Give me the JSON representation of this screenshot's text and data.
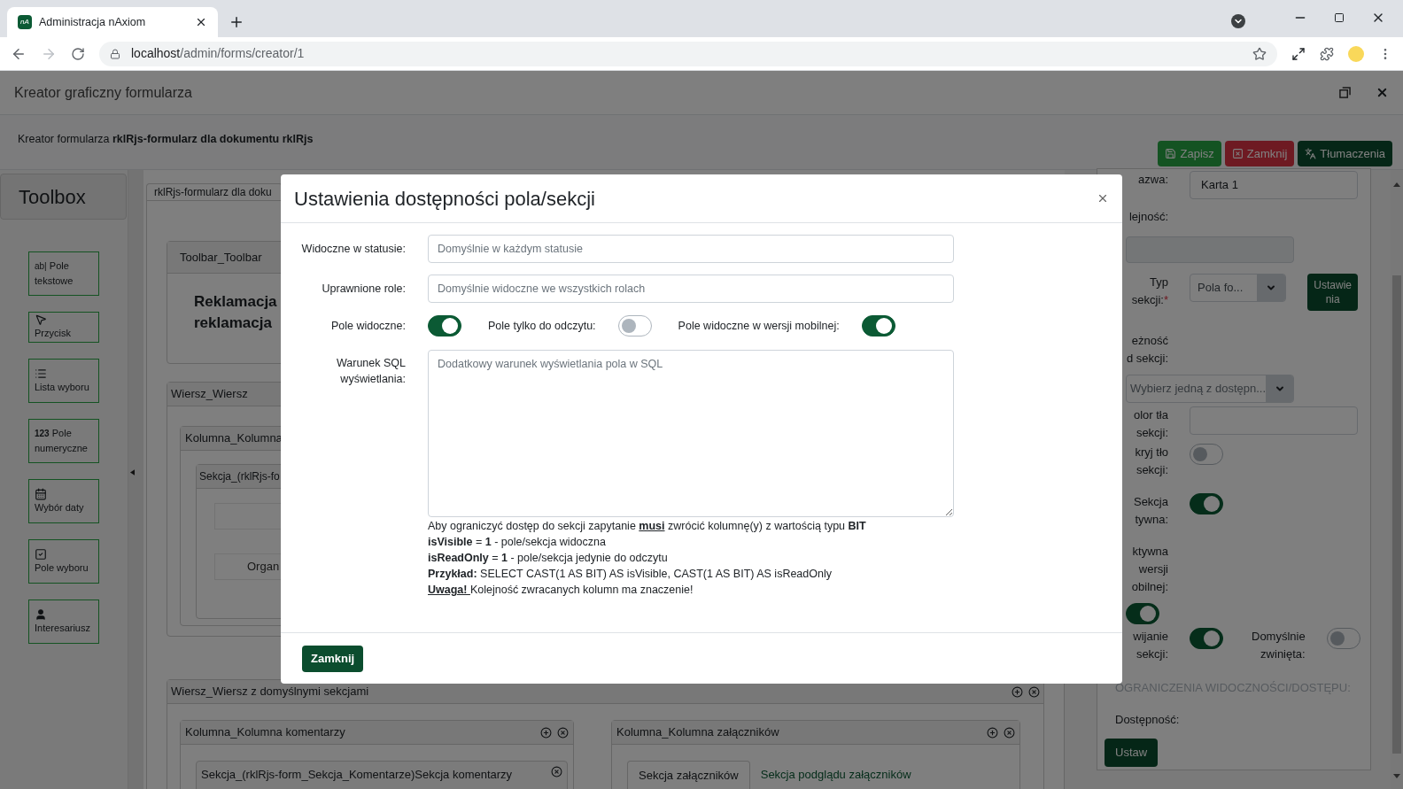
{
  "browser": {
    "tab_title": "Administracja nAxiom",
    "favicon": "nA",
    "url_host": "localhost",
    "url_path": "/admin/forms/creator/1"
  },
  "window": {
    "title": "Kreator graficzny formularza"
  },
  "subheader": {
    "text": "Kreator formularza **rklRjs-formularz dla dokumentu rklRjs**",
    "buttons": [
      {
        "label": "Zapisz",
        "kind": "save"
      },
      {
        "label": "Zamknij",
        "kind": "close"
      },
      {
        "label": "Tłumaczenia",
        "kind": "translate"
      }
    ]
  },
  "toolbox": {
    "title": "Toolbox",
    "items": [
      {
        "label": "Pole tekstowe",
        "kind": "text",
        "glyph": "ab|"
      },
      {
        "label": "Przycisk",
        "kind": "button"
      },
      {
        "label": "Lista wyboru",
        "kind": "list"
      },
      {
        "label": "Pole numeryczne",
        "kind": "number",
        "glyph": "123"
      },
      {
        "label": "Wybór daty",
        "kind": "date"
      },
      {
        "label": "Pole wyboru",
        "kind": "checkbox"
      },
      {
        "label": "Interesariusz",
        "kind": "person"
      }
    ]
  },
  "canvas": {
    "tab": "rklRjs-formularz dla doku",
    "toolbar": {
      "title": "Toolbar_Toolbar",
      "heading": [
        "Reklamacja",
        "reklamacja"
      ]
    },
    "row1": {
      "title": "Wiersz_Wiersz",
      "column": "Kolumna_Kolumna",
      "section": "Sekcja_(rklRjs-fo",
      "field": "Organ"
    },
    "row2": {
      "title": "Wiersz_Wiersz z domyślnymi sekcjami",
      "columns": [
        {
          "title": "Kolumna_Kolumna komentarzy",
          "kind": "sections",
          "section": "Sekcja_(rklRjs-form_Sekcja_Komentarze)Sekcja komentarzy"
        },
        {
          "title": "Kolumna_Kolumna załączników",
          "kind": "tabs",
          "tabs": [
            {
              "label": "Sekcja załączników",
              "selected": true
            },
            {
              "label": "Sekcja podglądu załączników",
              "selected": false
            }
          ]
        }
      ]
    }
  },
  "properties": {
    "rows": [
      {
        "kind": "input",
        "label": [
          "azwa:"
        ],
        "value": "Karta 1"
      },
      {
        "kind": "label",
        "label": [
          "lejność:"
        ]
      },
      {
        "kind": "blank"
      },
      {
        "kind": "select",
        "label": [
          "Typ",
          "sekcji:"
        ],
        "required": true,
        "required_mark": "*",
        "value": "Pola fo...",
        "action": "Ustawienia"
      },
      {
        "kind": "label",
        "label": [
          "eżność",
          "d sekcji:"
        ]
      },
      {
        "kind": "wide-select",
        "value": "Wybierz jedną z dostępn..."
      },
      {
        "kind": "input",
        "label": [
          "olor tła",
          "sekcji:"
        ]
      },
      {
        "kind": "toggle",
        "label": [
          "kryj tło",
          "sekcji:"
        ],
        "on": false
      },
      {
        "kind": "toggle",
        "label": [
          "Sekcja",
          "tywna:"
        ],
        "on": true
      },
      {
        "kind": "label",
        "label": [
          "ktywna",
          "wersji",
          "obilnej:"
        ]
      },
      {
        "kind": "edge-toggle",
        "on": true
      },
      {
        "kind": "toggle-pair",
        "label": [
          "wijanie",
          "sekcji:"
        ],
        "on": true,
        "second_label": [
          "Domyślnie",
          "zwinięta:"
        ],
        "second_on": false
      },
      {
        "kind": "heading",
        "label": [
          "OGRANICZENIA WIDOCZNOŚCI/DOSTĘPU:"
        ]
      },
      {
        "kind": "plain",
        "label": [
          "Dostępność:"
        ]
      },
      {
        "kind": "button",
        "label": [
          "Ustaw"
        ]
      }
    ]
  },
  "modal": {
    "title": "Ustawienia dostępności pola/sekcji",
    "fields": [
      {
        "label": "Widoczne w statusie:",
        "placeholder": "Domyślnie w każdym statusie"
      },
      {
        "label": "Uprawnione role:",
        "placeholder": "Domyślnie widoczne we wszystkich rolach"
      }
    ],
    "toggles": [
      {
        "label": "Pole widoczne:",
        "on": true
      },
      {
        "label": "Pole tylko do odczytu:",
        "on": false
      },
      {
        "label": "Pole widoczne w wersji mobilnej:",
        "on": true
      }
    ],
    "sql": {
      "label": "Warunek SQL wyświetlania:",
      "placeholder": "Dodatkowy warunek wyświetlania pola w SQL"
    },
    "help": [
      [
        {
          "text": "Aby ograniczyć dostęp do sekcji zapytanie ",
          "kind": "plain"
        },
        {
          "text": "musi",
          "kind": "bold-underline"
        },
        {
          "text": " zwrócić kolumnę(y) z wartością typu ",
          "kind": "plain"
        },
        {
          "text": "BIT",
          "kind": "bold"
        }
      ],
      [
        {
          "text": "isVisible",
          "kind": "bold"
        },
        {
          "text": " = ",
          "kind": "plain"
        },
        {
          "text": "1",
          "kind": "bold"
        },
        {
          "text": " - pole/sekcja widoczna",
          "kind": "plain"
        }
      ],
      [
        {
          "text": "isReadOnly",
          "kind": "bold"
        },
        {
          "text": " = ",
          "kind": "plain"
        },
        {
          "text": "1",
          "kind": "bold"
        },
        {
          "text": " - pole/sekcja jedynie do odczytu",
          "kind": "plain"
        }
      ],
      [
        {
          "text": "Przykład:",
          "kind": "bold"
        },
        {
          "text": " SELECT CAST(1 AS BIT) AS isVisible, CAST(1 AS BIT) AS isReadOnly",
          "kind": "plain"
        }
      ],
      [
        {
          "text": "Uwaga! ",
          "kind": "bold-underline"
        },
        {
          "text": "Kolejność zwracanych kolumn ma znaczenie!",
          "kind": "plain"
        }
      ]
    ],
    "footer_button": "Zamknij"
  }
}
